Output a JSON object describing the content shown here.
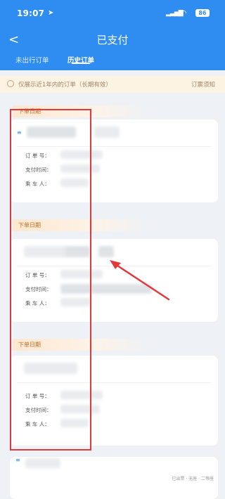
{
  "status_bar": {
    "time": "19:07",
    "location_icon": "location-arrow-icon",
    "battery": "86"
  },
  "nav": {
    "back_icon": "chevron-left-icon",
    "title": "已支付"
  },
  "tabs": [
    {
      "label": "未出行订单"
    },
    {
      "label": "历史订单"
    }
  ],
  "notice": {
    "text": "仅展示近1年内的订单（长期有效）",
    "more": "订票须知"
  },
  "orders": [
    {
      "group": "下单日期",
      "fields": [
        {
          "label": "订 单 号："
        },
        {
          "label": "支付时间："
        },
        {
          "label": "乘 车 人："
        }
      ]
    },
    {
      "group": "下单日期",
      "fields": [
        {
          "label": "订 单 号："
        },
        {
          "label": "支付时间："
        },
        {
          "label": "乘 车 人："
        }
      ]
    },
    {
      "group": "下单日期",
      "fields": [
        {
          "label": "订 单 号："
        },
        {
          "label": "支付时间："
        },
        {
          "label": "乘 车 人："
        }
      ]
    }
  ],
  "footer_text": "已出票 · 无座 · 二等座",
  "colors": {
    "header": "#2f8cf0",
    "annotation": "#e23a3a",
    "notice_bg": "#fdf3e3"
  }
}
